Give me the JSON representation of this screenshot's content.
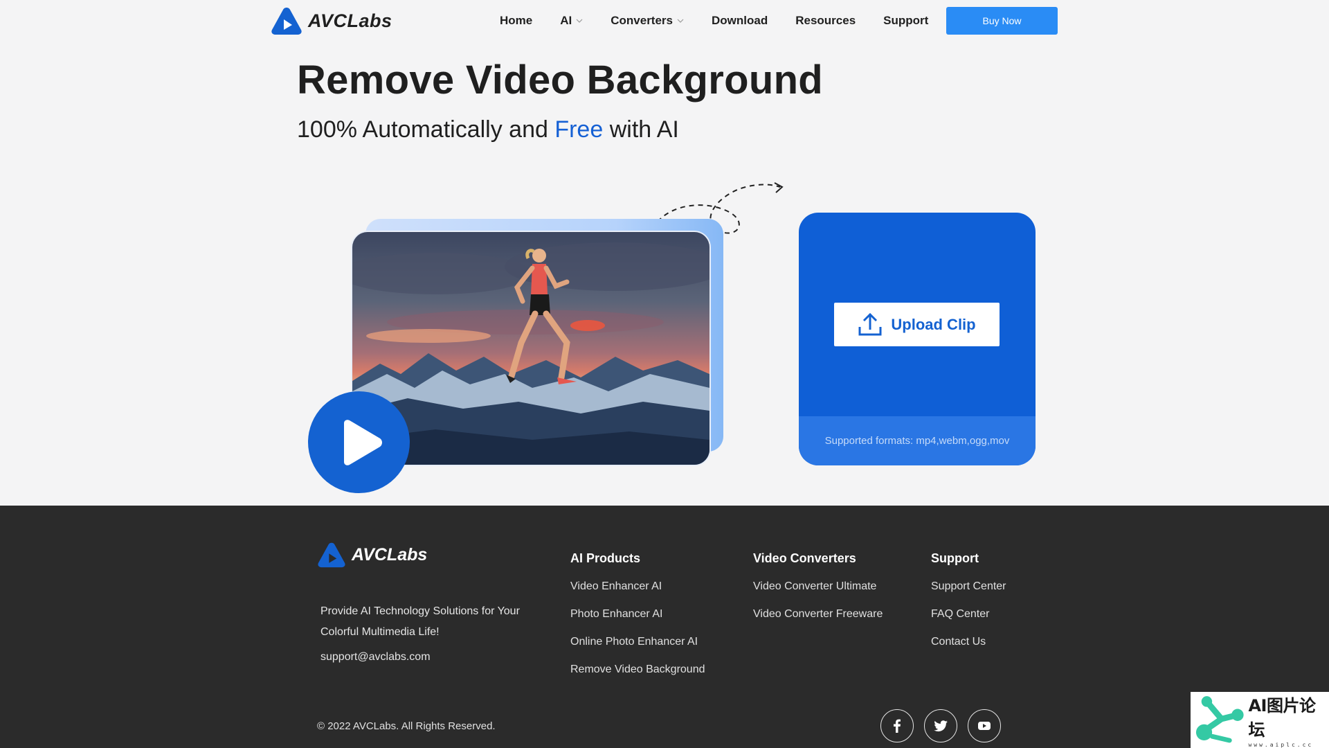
{
  "header": {
    "logo_text": "AVCLabs",
    "nav": [
      {
        "label": "Home",
        "has_dropdown": false
      },
      {
        "label": "AI",
        "has_dropdown": true
      },
      {
        "label": "Converters",
        "has_dropdown": true
      },
      {
        "label": "Download",
        "has_dropdown": false
      },
      {
        "label": "Resources",
        "has_dropdown": false
      },
      {
        "label": "Support",
        "has_dropdown": false
      }
    ],
    "buy_label": "Buy Now"
  },
  "hero": {
    "title": "Remove Video Background",
    "subtitle_pre": "100% Automatically and ",
    "subtitle_accent": "Free",
    "subtitle_post": " with AI",
    "upload_label": "Upload Clip",
    "formats_text": "Supported formats: mp4,webm,ogg,mov"
  },
  "footer": {
    "logo_text": "AVCLabs",
    "tagline": "Provide AI Technology Solutions for Your Colorful Multimedia Life!",
    "email": "support@avclabs.com",
    "columns": [
      {
        "title": "AI Products",
        "links": [
          "Video Enhancer AI",
          "Photo Enhancer AI",
          "Online Photo Enhancer AI",
          "Remove Video Background"
        ]
      },
      {
        "title": "Video Converters",
        "links": [
          "Video Converter Ultimate",
          "Video Converter Freeware"
        ]
      },
      {
        "title": "Support",
        "links": [
          "Support Center",
          "FAQ Center",
          "Contact Us"
        ]
      }
    ],
    "copyright": "© 2022 AVCLabs. All Rights Reserved.",
    "socials": [
      "facebook-icon",
      "twitter-icon",
      "youtube-icon"
    ]
  },
  "watermark": {
    "text": "AI图片论坛",
    "url": "www.aiplc.cc"
  },
  "colors": {
    "accent": "#1560d4",
    "buy_button": "#2a8cf5",
    "upload_card": "#0f5fd6",
    "footer_bg": "#2b2b2b",
    "page_bg": "#f4f4f5"
  }
}
